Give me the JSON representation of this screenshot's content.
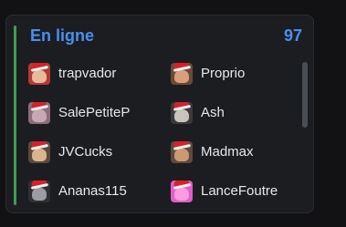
{
  "panel": {
    "title": "En ligne",
    "count": "97",
    "accent_color": "#3f9e4f",
    "title_color": "#4a8ef0"
  },
  "users": [
    {
      "name": "trapvador",
      "avatar_bg": "#b23a36",
      "face": "#e9b99a"
    },
    {
      "name": "Proprio",
      "avatar_bg": "#6a4a36",
      "face": "#d7a07a"
    },
    {
      "name": "SalePetiteP",
      "avatar_bg": "#8a6f78",
      "face": "#caa7b4"
    },
    {
      "name": "Ash",
      "avatar_bg": "#3a3a3a",
      "face": "#c8c3bd"
    },
    {
      "name": "JVCucks",
      "avatar_bg": "#5a4a3c",
      "face": "#d8b58d"
    },
    {
      "name": "Madmax",
      "avatar_bg": "#5c4a3c",
      "face": "#c99a73"
    },
    {
      "name": "Ananas115",
      "avatar_bg": "#2f3033",
      "face": "#9b9da2"
    },
    {
      "name": "LanceFoutre",
      "avatar_bg": "#e05fc6",
      "face": "#ff9be3"
    }
  ]
}
